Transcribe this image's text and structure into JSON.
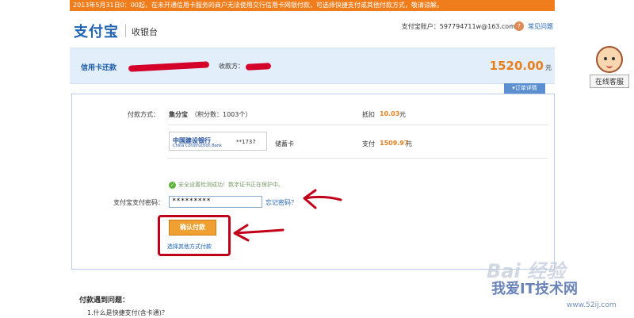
{
  "notice": "2013年5月31日0：00起，在未开通信用卡服务的商户无法使用交行信用卡网银付款，可选择快捷支付或其他付款方式，敬请谅解。",
  "header": {
    "logo": "支付宝",
    "subtitle": "收银台",
    "account_label": "支付宝账户：597794711w@163.com",
    "help_icon": "help-icon",
    "help_link": "常见问题"
  },
  "bill": {
    "title": "信用卡还款",
    "payee_label": "收款方：",
    "amount": "1520.00",
    "unit": "元",
    "details_tab": "▾订单详情"
  },
  "payment": {
    "method_label": "付款方式：",
    "points_name": "集分宝",
    "points_note": "（积分数：1003个）",
    "deduct_label": "抵扣",
    "deduct_amount": "10.03",
    "deduct_unit": "元",
    "bank_name": "中国建设银行",
    "bank_name_en": "China Construction Bank",
    "card_no": "**1737",
    "card_type": "储蓄卡",
    "pay_label": "支付",
    "pay_amount": "1509.97",
    "pay_unit": "元",
    "safety_msg": "安全设置检测成功！数字证书正在保护中。",
    "password_label": "支付宝支付密码：",
    "password_value": "*********",
    "forgot_link": "忘记密码？",
    "confirm_button": "确认付款",
    "other_method_link": "选择其他方式付款"
  },
  "faq": {
    "title": "付款遇到问题：",
    "q1": "1.什么是快捷支付(含卡通)？"
  },
  "service": {
    "label": "在线客服"
  },
  "watermark": {
    "main": "Bai 经验",
    "sub": "我爱IT技术网",
    "url": "www.52ij.com"
  },
  "colors": {
    "accent_orange": "#f07d1c",
    "link_blue": "#1e63b4",
    "annotation_red": "#c0001a"
  }
}
